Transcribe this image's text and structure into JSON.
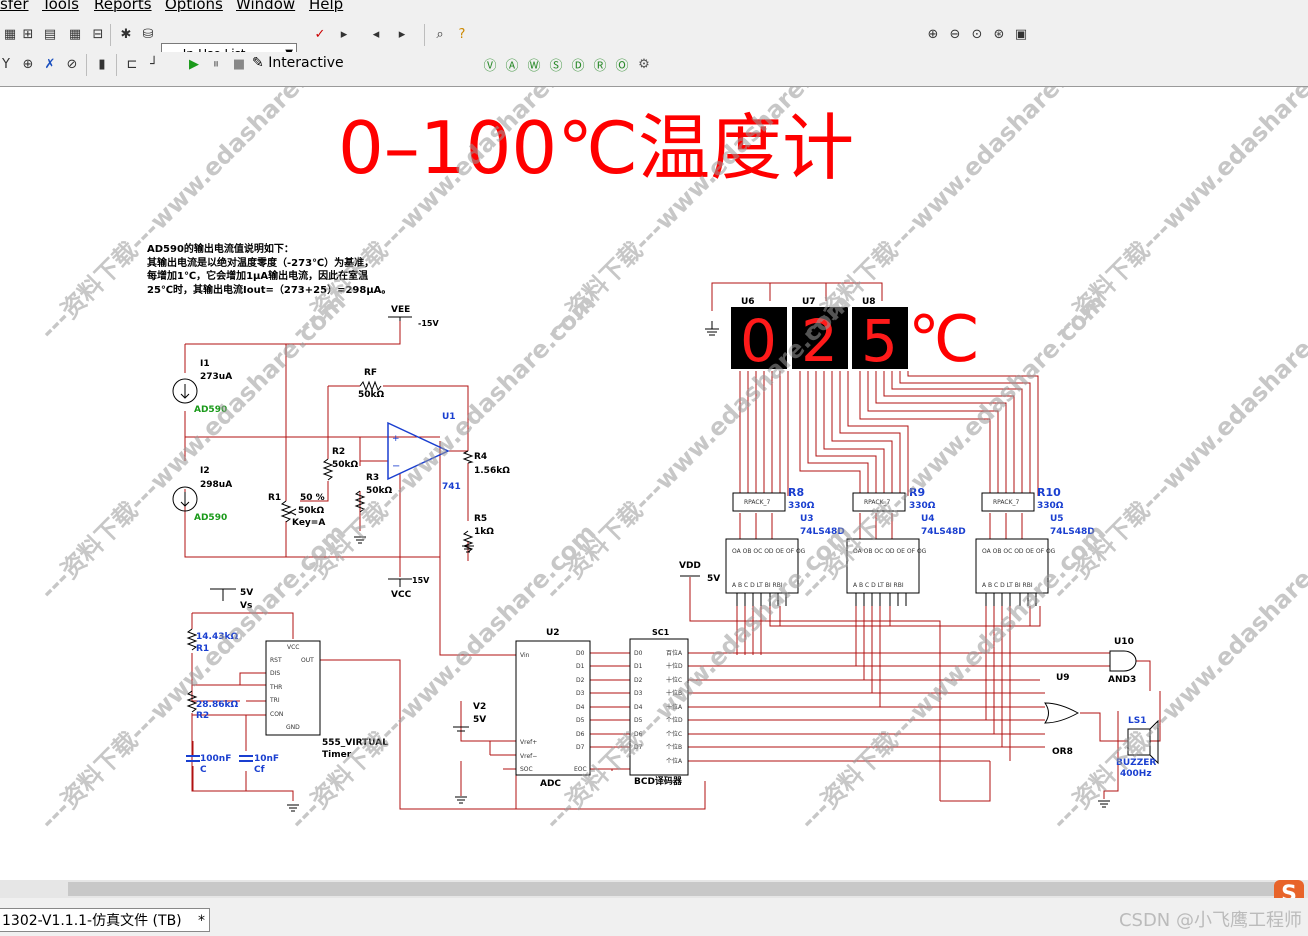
{
  "menubar": {
    "items": [
      "sfer",
      "Tools",
      "Reports",
      "Options",
      "Window",
      "Help"
    ]
  },
  "toolbar": {
    "component_list": "--- In-Use List ---",
    "interactive_label": "Interactive"
  },
  "schematic": {
    "title": "0–100℃温度计",
    "note_lines": [
      "AD590的输出电流值说明如下：",
      "其输出电流是以绝对温度零度（-273℃）为基准，",
      "每增加1℃，它会增加1μA输出电流，因此在室温",
      "25℃时，其输出电流Iout=（273+25）=298μA。"
    ],
    "display_digits": [
      "0",
      "2",
      "5"
    ],
    "display_unit": "℃",
    "display_refs": [
      "U6",
      "U7",
      "U8"
    ],
    "labels": {
      "vee": "VEE",
      "vee_val": "-15V",
      "vcc": "VCC",
      "vcc_val": "15V",
      "i1": "I1",
      "i1_val": "273uA",
      "i1_part": "AD590",
      "i2": "I2",
      "i2_val": "298uA",
      "i2_part": "AD590",
      "rf": "RF",
      "rf_val": "50kΩ",
      "r2": "R2",
      "r2_val": "50kΩ",
      "r3": "R3",
      "r3_val": "50kΩ",
      "r1": "R1",
      "r1_pct": "50 %",
      "r1_val": "50kΩ",
      "r1_key": "Key=A",
      "u1": "U1",
      "u1_part": "741",
      "r4": "R4",
      "r4_val": "1.56kΩ",
      "r5": "R5",
      "r5_val": "1kΩ",
      "vs": "5V",
      "vs_name": "Vs",
      "t_r1": "14.43kΩ",
      "t_r1_name": "R1",
      "t_r2": "28.86kΩ",
      "t_r2_name": "R2",
      "c": "100nF",
      "c_name": "C",
      "cf": "10nF",
      "cf_name": "Cf",
      "timer": "555_VIRTUAL",
      "timer2": "Timer",
      "u2": "U2",
      "adc": "ADC",
      "sc1": "SC1",
      "bcd": "BCD译码器",
      "v2": "V2",
      "v2_val": "5V",
      "vdd": "VDD",
      "vdd_val": "5V",
      "r8": "R8",
      "r8_val": "330Ω",
      "u3": "U3",
      "u3_part": "74LS48D",
      "r9": "R9",
      "r9_val": "330Ω",
      "u4": "U4",
      "u4_part": "74LS48D",
      "r10": "R10",
      "r10_val": "330Ω",
      "u5": "U5",
      "u5_part": "74LS48D",
      "u10": "U10",
      "and3": "AND3",
      "u9": "U9",
      "or8": "OR8",
      "ls1": "LS1",
      "buzzer": "BUZZER",
      "buzzer_freq": "400Hz",
      "rpack": "RPACK_7"
    },
    "watermark": "---资料下载---www.edashare.com"
  },
  "statusbar": {
    "tab_label": "1302-V1.1.1-仿真文件 (TB)",
    "tab_close": "*",
    "credit": "CSDN @小飞鹰工程师"
  },
  "logo_letter": "S"
}
